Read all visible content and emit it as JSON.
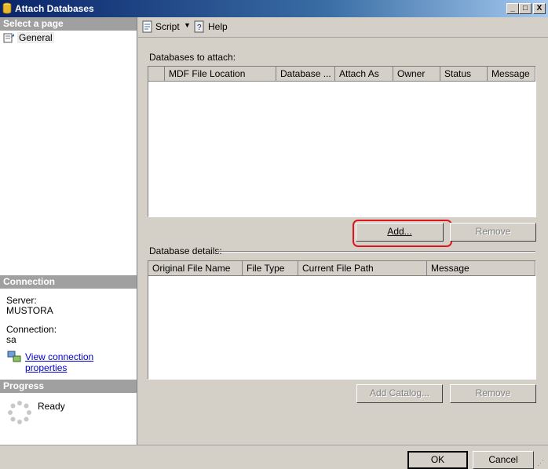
{
  "window": {
    "title": "Attach Databases",
    "controls": [
      "_",
      "□",
      "X"
    ]
  },
  "left_panel": {
    "select_page_header": "Select a page",
    "pages": [
      {
        "label": "General",
        "icon": "page-icon"
      }
    ],
    "connection_header": "Connection",
    "server_label": "Server:",
    "server_value": "MUSTORA",
    "connection_label": "Connection:",
    "connection_value": "sa",
    "view_connection_link": "View connection properties",
    "progress_header": "Progress",
    "progress_status": "Ready"
  },
  "toolbar": {
    "script_label": "Script",
    "help_label": "Help"
  },
  "attach": {
    "section_label": "Databases to attach:",
    "columns": [
      "",
      "MDF File Location",
      "Database ...",
      "Attach As",
      "Owner",
      "Status",
      "Message"
    ],
    "rows": [],
    "add_button": "Add...",
    "remove_button": "Remove"
  },
  "details": {
    "section_label": "Database details:",
    "columns": [
      "Original File Name",
      "File Type",
      "Current File Path",
      "Message"
    ],
    "rows": [],
    "add_catalog_button": "Add Catalog...",
    "remove_button": "Remove"
  },
  "footer": {
    "ok_button": "OK",
    "cancel_button": "Cancel"
  },
  "colors": {
    "titlebar": "#0a246a",
    "highlight": "#e0141e",
    "section_header": "#a0a0a0",
    "link": "#0000cc"
  }
}
